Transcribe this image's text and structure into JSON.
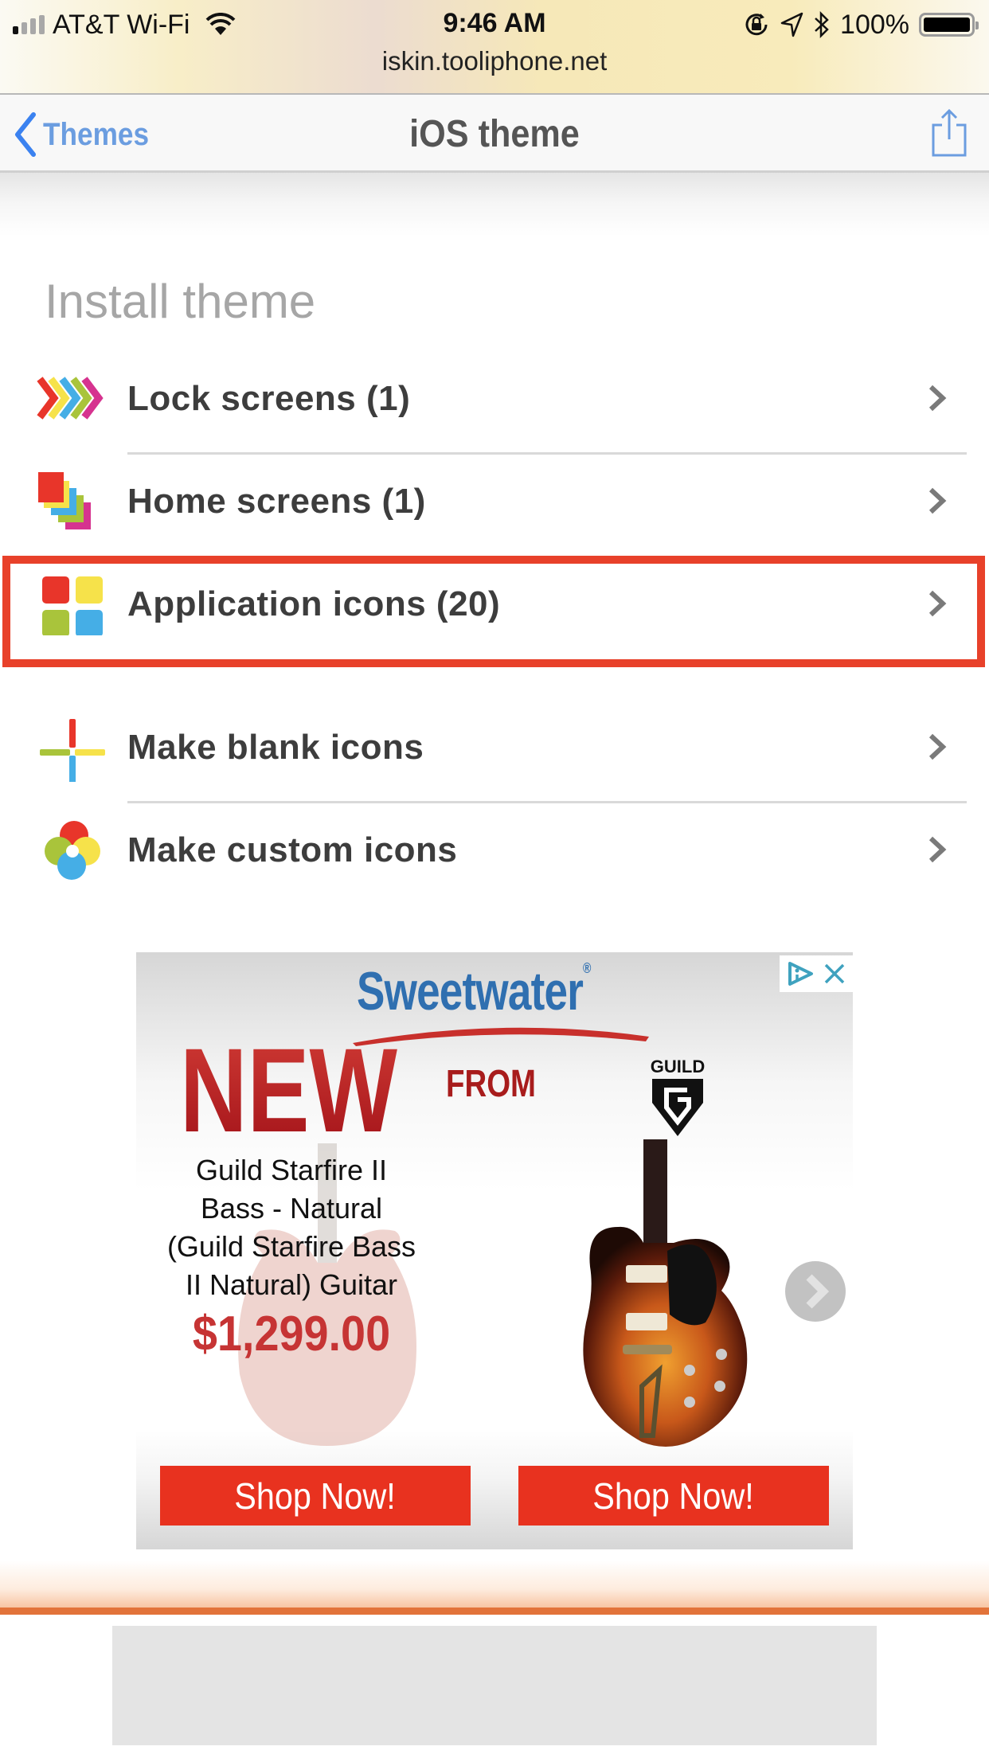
{
  "status_bar": {
    "carrier": "AT&T Wi-Fi",
    "signal_bars_active": 1,
    "signal_bars_total": 4,
    "time": "9:46 AM",
    "url": "iskin.tooliphone.net",
    "battery_percent": "100%",
    "icons": [
      "signal-icon",
      "wifi-icon",
      "orientation-lock-icon",
      "location-icon",
      "bluetooth-icon",
      "battery-icon"
    ]
  },
  "nav": {
    "back_label": "Themes",
    "title": "iOS theme",
    "share_icon": "share-icon",
    "back_icon": "chevron-left-icon"
  },
  "section": {
    "title": "Install theme"
  },
  "list": {
    "items": [
      {
        "label": "Lock screens (1)",
        "icon": "lock-screens-chevrons-icon",
        "highlighted": false
      },
      {
        "label": "Home screens (1)",
        "icon": "home-screens-stacked-squares-icon",
        "highlighted": false
      },
      {
        "label": "Application icons (20)",
        "icon": "app-icons-grid-icon",
        "highlighted": true
      },
      {
        "label": "Make blank icons",
        "icon": "blank-icons-cross-icon",
        "highlighted": false
      },
      {
        "label": "Make custom icons",
        "icon": "custom-icons-petals-icon",
        "highlighted": false
      }
    ]
  },
  "ad": {
    "brand": "Sweetwater",
    "headline_big": "NEW",
    "headline_small": "FROM",
    "maker_logo": "GUILD",
    "product_name": "Guild Starfire II Bass - Natural (Guild Starfire Bass II Natural) Guitar",
    "price": "$1,299.00",
    "buttons": [
      "Shop Now!",
      "Shop Now!"
    ],
    "adchoices_icon": "adchoices-icon",
    "close_icon": "close-icon"
  },
  "colors": {
    "accent_link": "#6b9de0",
    "highlight_border": "#e8412a",
    "shop_button": "#e8321f",
    "price": "#c63434",
    "footer_line": "#e2733a",
    "icon_red": "#e8352a",
    "icon_yellow": "#f6e24a",
    "icon_blue": "#45aee6",
    "icon_green": "#a9c43b",
    "icon_magenta": "#d6338f"
  }
}
